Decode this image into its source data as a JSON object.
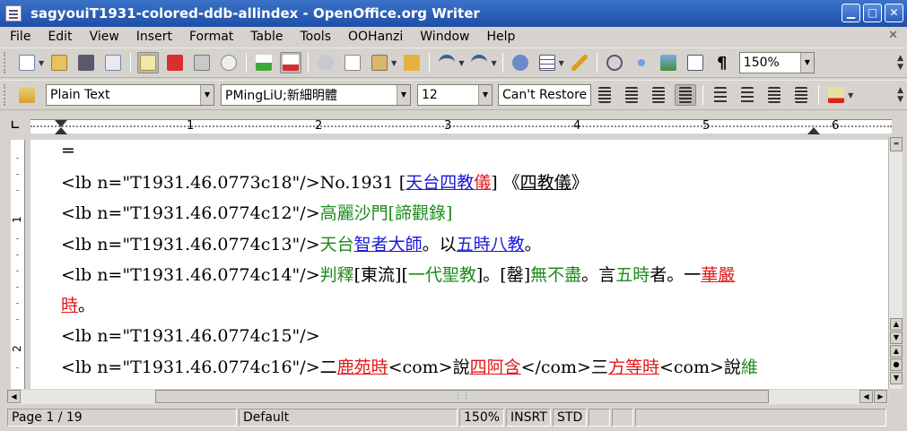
{
  "window": {
    "title": "sagyouiT1931-colored-ddb-allindex - OpenOffice.org Writer",
    "minimize": "▁",
    "maximize": "□",
    "close": "✕"
  },
  "menu": {
    "items": [
      "File",
      "Edit",
      "View",
      "Insert",
      "Format",
      "Table",
      "Tools",
      "OOHanzi",
      "Window",
      "Help"
    ],
    "close_doc": "✕"
  },
  "toolbar": {
    "zoom_value": "150%"
  },
  "formatting": {
    "paragraph_style": "Plain Text",
    "font_name": "PMingLiU;新細明體",
    "font_size": "12",
    "cant_restore": "Can't Restore"
  },
  "ruler": {
    "numbers": [
      "1",
      "2",
      "3",
      "4",
      "5",
      "6"
    ],
    "vnumbers": [
      "1",
      "2"
    ]
  },
  "document": {
    "line0": "=",
    "line1": {
      "tag": "<lb n=\"T1931.46.0773c18\"/>",
      "no": "No.1931 [",
      "t1": "天台四教",
      "t2": "儀",
      "t3": "] 《",
      "t4": "四教儀",
      "t5": "》"
    },
    "line2": {
      "tag": "<lb n=\"T1931.46.0774c12\"/>",
      "t1": "高麗沙門",
      "t2": "[諦觀",
      "t3": "錄]"
    },
    "line3": {
      "tag": "<lb n=\"T1931.46.0774c13\"/>",
      "t1": "天台",
      "t2": "智者大師",
      "t3": "。以",
      "t4": "五時八教",
      "t5": "。"
    },
    "line4": {
      "tag": "<lb n=\"T1931.46.0774c14\"/>",
      "t1": "判釋",
      "t2": "[東流]",
      "t3": "[",
      "t4": "一代聖教",
      "t5": "]。[",
      "t6": "罄",
      "t7": "]",
      "t8": "無不盡",
      "t9": "。言",
      "t10": "五時",
      "t11": "者。一",
      "t12": "華嚴"
    },
    "line5": {
      "t1": "時",
      "t2": "。"
    },
    "line6": {
      "tag": "<lb n=\"T1931.46.0774c15\"/>"
    },
    "line7": {
      "tag": "<lb n=\"T1931.46.0774c16\"/>",
      "t1": "二",
      "t2": "鹿苑時",
      "t3": "<com>說",
      "t4": "四阿含",
      "t5": "</com>三",
      "t6": "方等時",
      "t7": "<com>說",
      "t8": "維"
    }
  },
  "status": {
    "page": "Page 1 / 19",
    "style": "Default",
    "zoom": "150%",
    "insert": "INSRT",
    "selection": "STD"
  },
  "colors": {
    "title_bar": "#2a5cb6",
    "chrome": "#d6d3ce",
    "text_green": "#1c8a1c",
    "text_blue": "#1a1ad8",
    "text_red": "#e01818"
  }
}
